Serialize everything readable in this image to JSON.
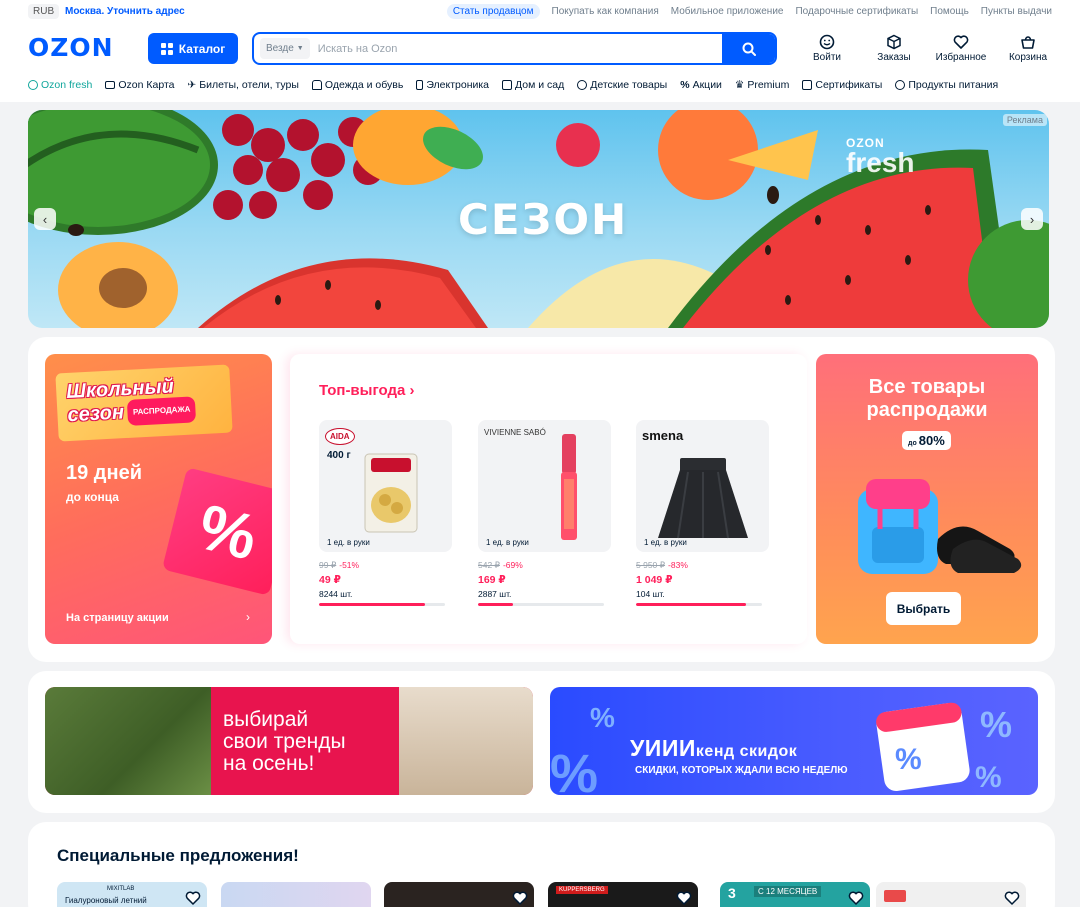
{
  "topbar": {
    "currency": "RUB",
    "city": "Москва. Уточнить адрес",
    "links": [
      "Стать продавцом",
      "Покупать как компания",
      "Мобильное приложение",
      "Подарочные сертификаты",
      "Помощь",
      "Пункты выдачи"
    ]
  },
  "header": {
    "logo": "OZON",
    "catalog_label": "Каталог",
    "search_scope": "Везде",
    "search_placeholder": "Искать на Ozon",
    "actions": {
      "login": "Войти",
      "orders": "Заказы",
      "favorites": "Избранное",
      "cart": "Корзина"
    }
  },
  "categories": [
    "Ozon fresh",
    "Ozon Карта",
    "Билеты, отели, туры",
    "Одежда и обувь",
    "Электроника",
    "Дом и сад",
    "Детские товары",
    "Акции",
    "Premium",
    "Сертификаты",
    "Продукты питания"
  ],
  "hero": {
    "title": "СЕЗОН",
    "ad_label": "Реклама",
    "brand_top": "OZON",
    "brand_bottom": "fresh"
  },
  "school": {
    "line1": "Школьный",
    "line2": "сезон",
    "pill": "РАСПРОДАЖА",
    "days": "19 дней",
    "days_sub": "до конца",
    "pct": "%",
    "link": "На страницу акции"
  },
  "top_deal": {
    "title": "Топ-выгода ›",
    "products": [
      {
        "brand": "AIDA",
        "weight": "400 г",
        "limit": "1 ед. в руки",
        "old_price": "99 ₽",
        "discount": "-51%",
        "price": "49 ₽",
        "stock": "8244 шт.",
        "sold_fraction": 0.84
      },
      {
        "brand": "VIVIENNE SABÓ",
        "limit": "1 ед. в руки",
        "old_price": "542 ₽",
        "discount": "-69%",
        "price": "169 ₽",
        "stock": "2887 шт.",
        "sold_fraction": 0.28
      },
      {
        "brand": "smena",
        "limit": "1 ед. в руки",
        "old_price": "5 950 ₽",
        "discount": "-83%",
        "price": "1 049 ₽",
        "stock": "104 шт.",
        "sold_fraction": 0.87
      }
    ]
  },
  "all_sale": {
    "line1": "Все товары",
    "line2": "распродажи",
    "upto_prefix": "до",
    "upto_value": "80%",
    "button": "Выбрать"
  },
  "banners": {
    "trend_line1": "выбирай",
    "trend_line2": "свои тренды",
    "trend_line3": "на осень!",
    "weekend_big": "УИИИ",
    "weekend_rest": "кенд скидок",
    "weekend_sub": "СКИДКИ, КОТОРЫХ ЖДАЛИ ВСЮ НЕДЕЛЮ"
  },
  "specials": {
    "title": "Специальные предложения!",
    "card1_brand": "MIXITLAB",
    "card1_label": "Гиалуроновый летний",
    "card4_label": "KUPPERSBERG",
    "card5_number": "3",
    "card5_label": "С 12 МЕСЯЦЕВ"
  },
  "colors": {
    "brand": "#005bff",
    "accent": "#ff1f5a",
    "fresh": "#10a69c"
  }
}
